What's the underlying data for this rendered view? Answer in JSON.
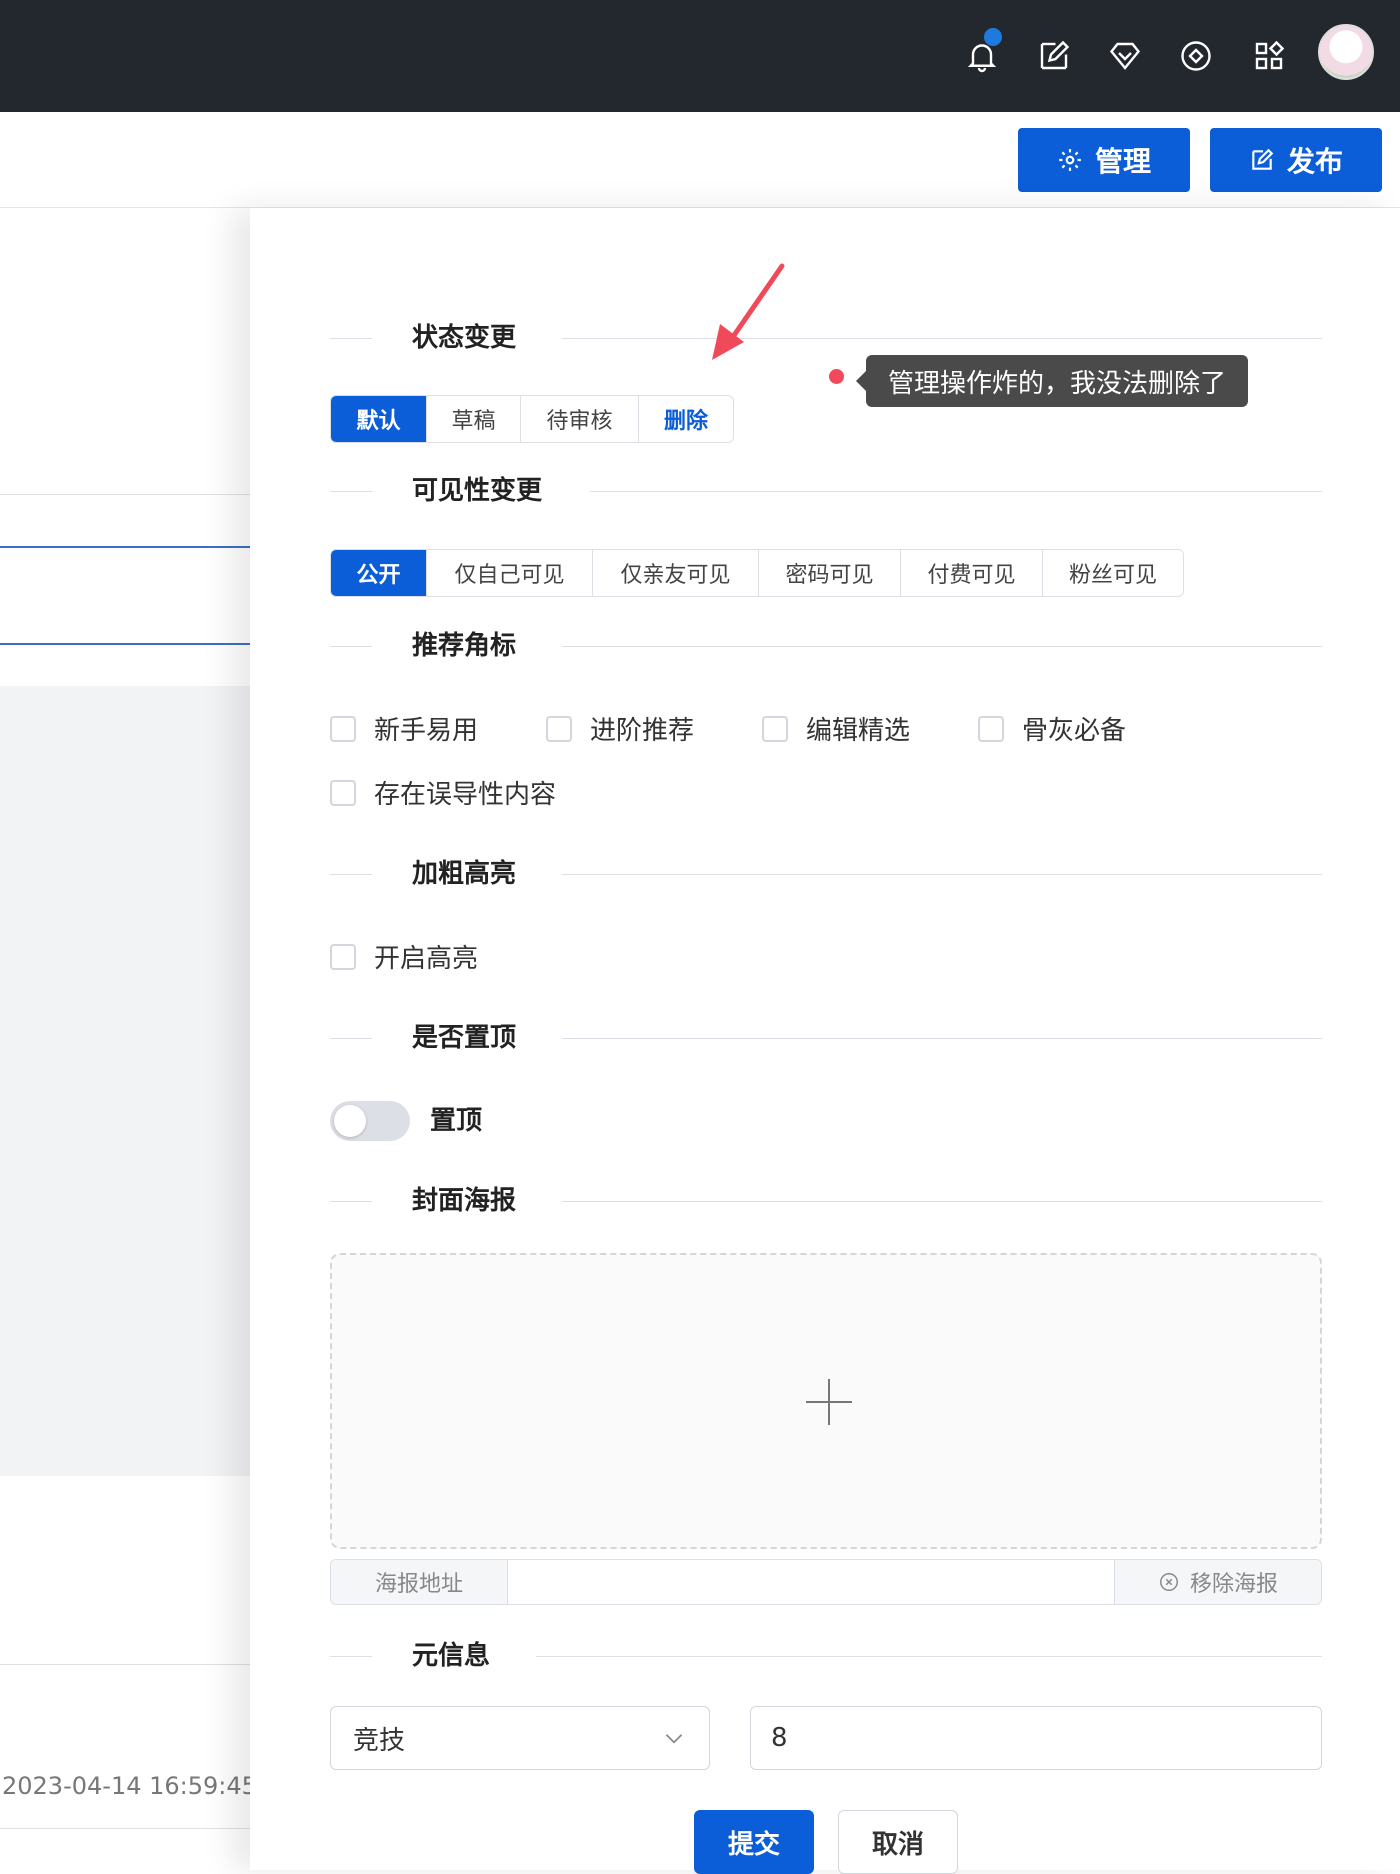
{
  "header": {
    "icons": [
      "bell-icon",
      "edit-icon",
      "gem-icon",
      "diamond-circle-icon",
      "apps-grid-icon"
    ],
    "manage_label": "管理",
    "publish_label": "发布"
  },
  "background": {
    "date": "2023-04-14 16:59:45"
  },
  "drawer": {
    "status": {
      "title": "状态变更",
      "options": [
        "默认",
        "草稿",
        "待审核",
        "删除"
      ],
      "selected": "默认"
    },
    "visibility": {
      "title": "可见性变更",
      "options": [
        "公开",
        "仅自己可见",
        "仅亲友可见",
        "密码可见",
        "付费可见",
        "粉丝可见"
      ],
      "selected": "公开"
    },
    "badges": {
      "title": "推荐角标",
      "options": [
        "新手易用",
        "进阶推荐",
        "编辑精选",
        "骨灰必备",
        "存在误导性内容"
      ]
    },
    "highlight": {
      "title": "加粗高亮",
      "option": "开启高亮"
    },
    "pin": {
      "title": "是否置顶",
      "label": "置顶",
      "on": false
    },
    "poster": {
      "title": "封面海报",
      "url_prefix": "海报地址",
      "url_value": "",
      "remove_label": "移除海报"
    },
    "meta": {
      "title": "元信息",
      "category": "竞技",
      "value": "8"
    },
    "submit_label": "提交",
    "cancel_label": "取消"
  },
  "annotation": {
    "tooltip": "管理操作炸的，我没法删除了",
    "colors": {
      "arrow": "#f04a5a",
      "dot": "#f04a5a"
    }
  },
  "colors": {
    "primary": "#0b5ed7",
    "topbar": "#23272e"
  }
}
